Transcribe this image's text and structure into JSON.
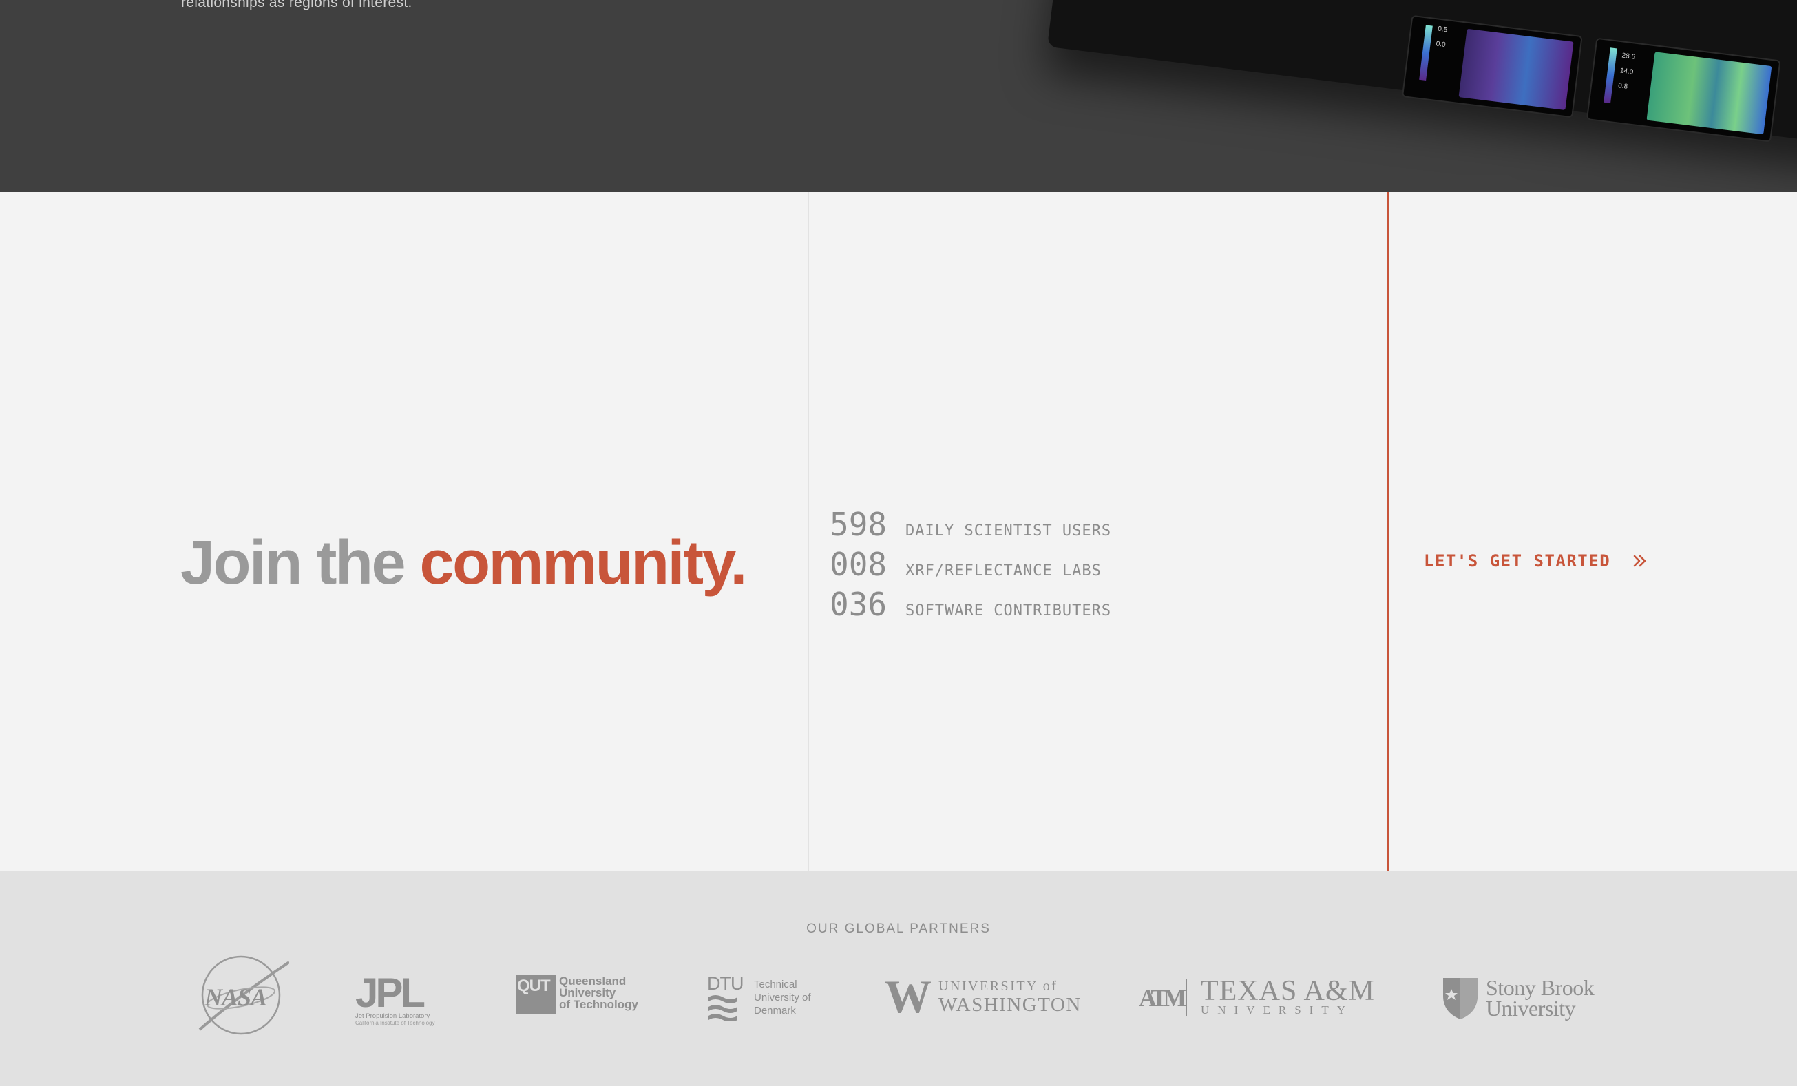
{
  "top": {
    "caption": "relationships as regions of interest.",
    "panels": [
      {
        "labels": [
          "0.5",
          "0.0"
        ]
      },
      {
        "labels": [
          "28.6",
          "14.0",
          "0.8"
        ]
      }
    ]
  },
  "community": {
    "headline_part1": "Join the ",
    "headline_part2": "community."
  },
  "stats": [
    {
      "number": "598",
      "label": "DAILY SCIENTIST USERS"
    },
    {
      "number": "008",
      "label": "XRF/REFLECTANCE LABS"
    },
    {
      "number": "036",
      "label": "SOFTWARE CONTRIBUTERS"
    }
  ],
  "cta": {
    "label": "LET'S GET STARTED",
    "icon": "double-chevron-right-icon"
  },
  "partners": {
    "title": "OUR GLOBAL PARTNERS",
    "logos": [
      {
        "name": "NASA",
        "text": "NASA"
      },
      {
        "name": "JPL",
        "text": "JPL",
        "sub1": "Jet Propulsion Laboratory",
        "sub2": "California Institute of Technology"
      },
      {
        "name": "QUT",
        "text": "QUT",
        "line1": "Queensland",
        "line2": "University",
        "line3": "of Technology"
      },
      {
        "name": "DTU",
        "text": "DTU",
        "line1": "Technical",
        "line2": "University of",
        "line3": "Denmark"
      },
      {
        "name": "UW",
        "text": "W",
        "line1": "UNIVERSITY of",
        "line2": "WASHINGTON"
      },
      {
        "name": "TAMU",
        "text": "ATM",
        "line1": "TEXAS A&M",
        "line2": "UNIVERSITY"
      },
      {
        "name": "SBU",
        "line1": "Stony Brook",
        "line2": "University"
      }
    ]
  },
  "colors": {
    "accent": "#c8553a",
    "dark_band": "#404040",
    "light_bg": "#f3f3f3",
    "partners_bg": "#e1e1e1"
  }
}
